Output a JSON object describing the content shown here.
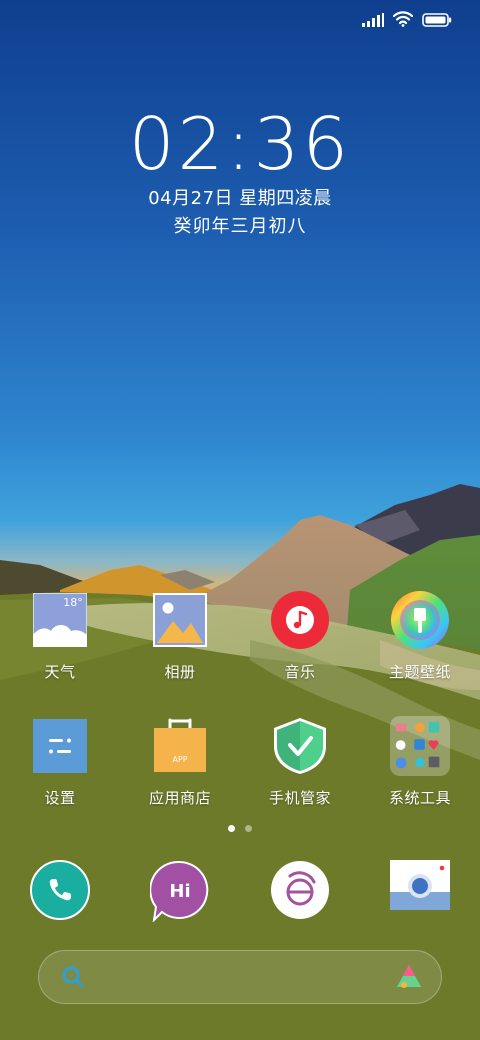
{
  "status_bar": {
    "icons": [
      "signal-icon",
      "wifi-icon",
      "battery-icon"
    ]
  },
  "clock": {
    "time": "02:36",
    "date": "04月27日 星期四凌晨",
    "lunar": "癸卯年三月初八"
  },
  "apps": [
    {
      "name": "weather",
      "label": "天气",
      "temp": "18°"
    },
    {
      "name": "gallery",
      "label": "相册"
    },
    {
      "name": "music",
      "label": "音乐"
    },
    {
      "name": "themes",
      "label": "主题壁纸"
    },
    {
      "name": "settings",
      "label": "设置"
    },
    {
      "name": "app-store",
      "label": "应用商店",
      "badge": "APP"
    },
    {
      "name": "security",
      "label": "手机管家"
    },
    {
      "name": "system-tools",
      "label": "系统工具"
    }
  ],
  "dock": [
    {
      "name": "phone",
      "icon": "phone-icon"
    },
    {
      "name": "messages",
      "icon": "messages-icon",
      "text": "Hi"
    },
    {
      "name": "browser",
      "icon": "browser-icon",
      "text": "e"
    },
    {
      "name": "camera",
      "icon": "camera-icon"
    }
  ],
  "page_indicator": {
    "current": 1,
    "total": 2
  },
  "colors": {
    "sky_top": "#0f3f8e",
    "ground": "#6d7a2a",
    "music_red": "#ec2a3a",
    "phone_teal": "#1aaea0",
    "messages_purple": "#a150a3"
  }
}
